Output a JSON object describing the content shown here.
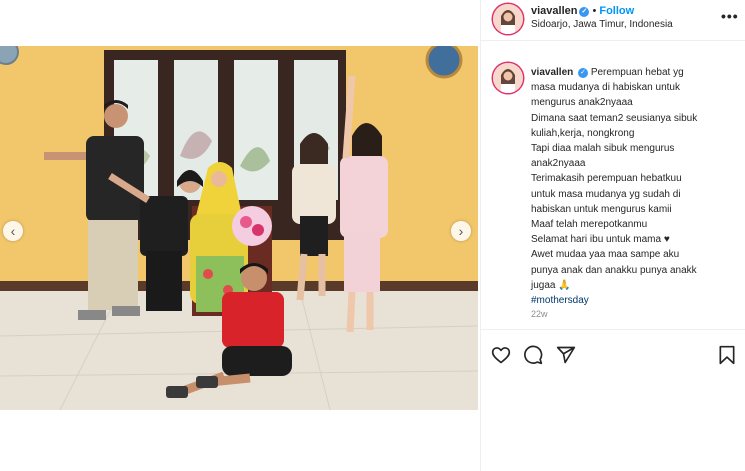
{
  "post": {
    "username": "viavallen",
    "verified_glyph": "✓",
    "separator": "•",
    "follow_label": "Follow",
    "location": "Sidoarjo, Jawa Timur, Indonesia",
    "more_icon": "more-horizontal-icon",
    "caption_lines": [
      "Perempuan hebat yg",
      "masa mudanya di habiskan untuk",
      "mengurus anak2nyaaa",
      "Dimana saat teman2 seusianya sibuk",
      "kuliah,kerja, nongkrong",
      "Tapi diaa malah sibuk mengurus",
      "anak2nyaaa",
      "Terimakasih perempuan hebatkuu",
      "untuk masa mudanya yg sudah di",
      "habiskan untuk mengurus kamii",
      "Maaf telah merepotkanmu",
      "Selamat hari ibu untuk mama ♥",
      "Awet mudaa yaa maa sampe aku",
      "punya anak dan anakku punya anakk",
      "jugaa 🙏"
    ],
    "hashtag": "#mothersday",
    "time_ago": "22w"
  },
  "media": {
    "prev_glyph": "‹",
    "next_glyph": "›"
  },
  "icons": [
    "heart-icon",
    "comment-icon",
    "share-icon",
    "bookmark-icon",
    "verified-badge-icon"
  ]
}
